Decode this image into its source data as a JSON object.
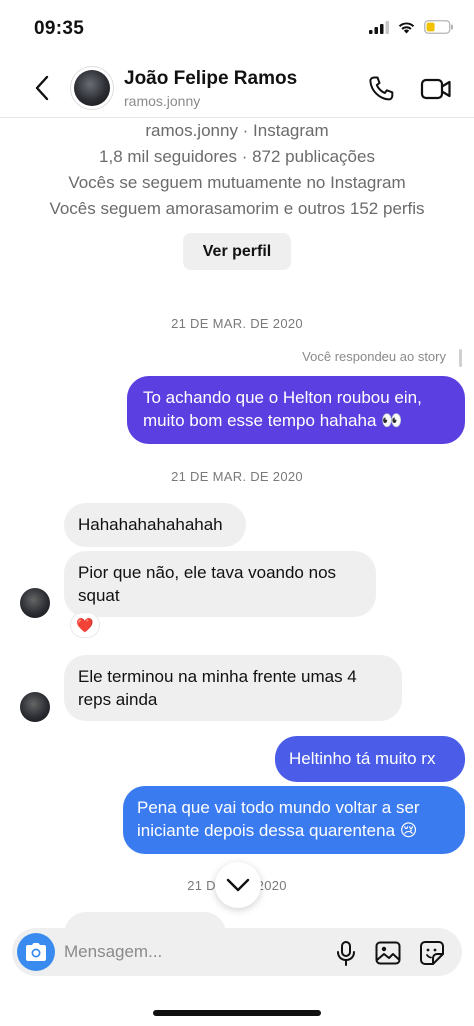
{
  "status_bar": {
    "time": "09:35"
  },
  "header": {
    "name": "João Felipe Ramos",
    "username": "ramos.jonny"
  },
  "profile": {
    "line1": "ramos.jonny · Instagram",
    "line2": "1,8 mil seguidores · 872 publicações",
    "line3": "Vocês se seguem mutuamente no Instagram",
    "line4": "Vocês seguem amorasamorim e outros 152 perfis",
    "view_profile_label": "Ver perfil"
  },
  "chat": {
    "date_1": "21 DE MAR. DE 2020",
    "reply_note": "Você respondeu ao story",
    "msg_1": "To achando que o Helton roubou ein, muito bom esse tempo hahaha 👀",
    "date_2": "21 DE MAR. DE 2020",
    "msg_2": "Hahahahahahahah",
    "msg_3": "Pior que não, ele tava voando nos squat",
    "reaction": "❤️",
    "msg_4": "Ele terminou na minha frente umas 4 reps ainda",
    "msg_5": "Heltinho tá muito rx",
    "msg_6": "Pena que vai todo mundo voltar a ser iniciante depois dessa quarentena 😢",
    "date_3": "21 DE M    E 2020"
  },
  "composer": {
    "placeholder": "Mensagem..."
  },
  "colors": {
    "bubble_out_top": "#5b3fe0",
    "bubble_out_bottom": "#3a7bf0",
    "bubble_in": "#efefef",
    "camera": "#3a8bf0"
  }
}
